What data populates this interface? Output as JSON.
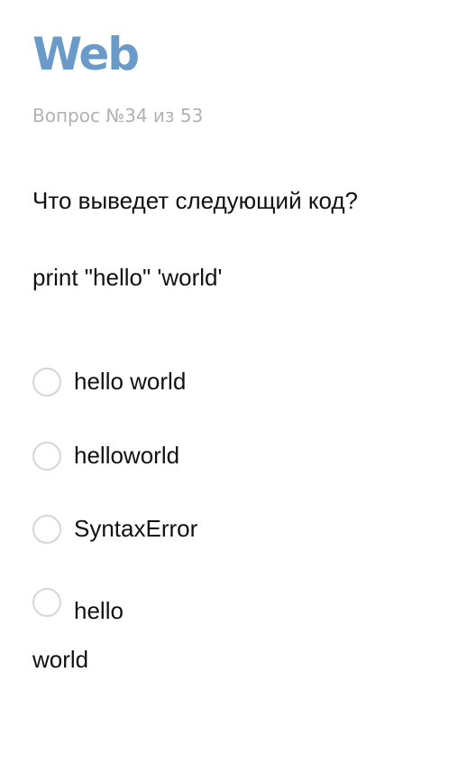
{
  "brand": {
    "title": "Web",
    "color": "#6a9bc8"
  },
  "quiz": {
    "counter": "Вопрос №34 из 53",
    "question": "Что выведет следующий код?",
    "code": "print \"hello\" 'world'",
    "options": [
      {
        "label": "hello world"
      },
      {
        "label": "helloworld"
      },
      {
        "label": "SyntaxError"
      },
      {
        "label": "hello\nworld"
      }
    ]
  }
}
